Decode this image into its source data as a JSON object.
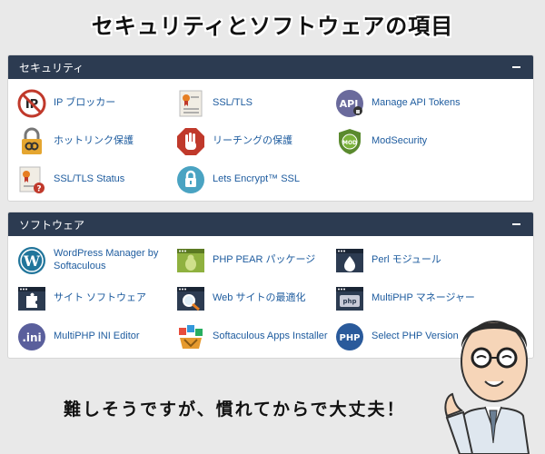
{
  "banner": {
    "title": "セキュリティとソフトウェアの項目"
  },
  "security": {
    "header": "セキュリティ",
    "items": [
      {
        "label": "IP ブロッカー",
        "icon": "ip-blocker-icon"
      },
      {
        "label": "SSL/TLS",
        "icon": "ssl-certificate-icon"
      },
      {
        "label": "Manage API Tokens",
        "icon": "api-tokens-icon"
      },
      {
        "label": "ホットリンク保護",
        "icon": "hotlink-chain-lock-icon"
      },
      {
        "label": "リーチングの保護",
        "icon": "hand-stop-icon"
      },
      {
        "label": "ModSecurity",
        "icon": "mod-shield-icon"
      },
      {
        "label": "SSL/TLS Status",
        "icon": "ssl-status-icon"
      },
      {
        "label": "Lets Encrypt™ SSL",
        "icon": "lock-circle-icon"
      }
    ]
  },
  "software": {
    "header": "ソフトウェア",
    "items": [
      {
        "label": "WordPress Manager by Softaculous",
        "icon": "wordpress-icon"
      },
      {
        "label": "PHP PEAR パッケージ",
        "icon": "pear-icon"
      },
      {
        "label": "Perl モジュール",
        "icon": "perl-onion-icon"
      },
      {
        "label": "サイト ソフトウェア",
        "icon": "puzzle-icon"
      },
      {
        "label": "Web サイトの最適化",
        "icon": "optimize-magnifier-icon"
      },
      {
        "label": "MultiPHP マネージャー",
        "icon": "multiphp-manager-icon"
      },
      {
        "label": "MultiPHP INI Editor",
        "icon": "ini-editor-icon"
      },
      {
        "label": "Softaculous Apps Installer",
        "icon": "softaculous-icon"
      },
      {
        "label": "Select PHP Version",
        "icon": "php-version-icon"
      }
    ]
  },
  "caption": "難しそうですが、慣れてからで大丈夫！",
  "colors": {
    "header_bg": "#2c3b51",
    "link": "#1d5b9e",
    "background": "#e9e9e9"
  }
}
